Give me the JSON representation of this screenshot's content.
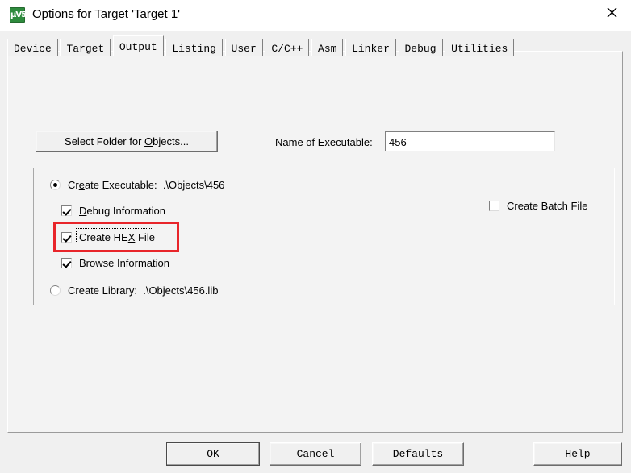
{
  "window": {
    "title": "Options for Target 'Target 1'",
    "icon": "keil-uvision-icon",
    "icon_glyph": "μV5",
    "close_label": "✕"
  },
  "tabs": [
    {
      "label": "Device",
      "selected": false
    },
    {
      "label": "Target",
      "selected": false
    },
    {
      "label": "Output",
      "selected": true
    },
    {
      "label": "Listing",
      "selected": false
    },
    {
      "label": "User",
      "selected": false
    },
    {
      "label": "C/C++",
      "selected": false
    },
    {
      "label": "Asm",
      "selected": false
    },
    {
      "label": "Linker",
      "selected": false
    },
    {
      "label": "Debug",
      "selected": false
    },
    {
      "label": "Utilities",
      "selected": false
    }
  ],
  "output_tab": {
    "select_folder_button": {
      "pre": "Select Folder for ",
      "accel": "O",
      "post": "bjects..."
    },
    "executable_name": {
      "accel": "N",
      "label_rest": "ame of Executable:",
      "value": "456",
      "placeholder": ""
    },
    "group": {
      "create_executable": {
        "pre": "Cr",
        "accel": "e",
        "post": "ate Executable:",
        "path": ".\\Objects\\456",
        "checked": true
      },
      "debug_information": {
        "accel": "D",
        "label_rest": "ebug Information",
        "checked": true
      },
      "create_hex_file": {
        "pre": "Create HE",
        "accel": "X",
        "post": " File",
        "checked": true,
        "focused": true,
        "highlighted": true,
        "highlight_color": "#e8252a"
      },
      "browse_information": {
        "pre": "Bro",
        "accel": "w",
        "post": "se Information",
        "checked": true
      },
      "create_library": {
        "label": "Create Library:",
        "path": ".\\Objects\\456.lib",
        "checked": false
      },
      "create_batch_file": {
        "label": "Create Batch File",
        "checked": false
      }
    }
  },
  "footer": {
    "ok": "OK",
    "cancel": "Cancel",
    "defaults": "Defaults",
    "help": "Help"
  }
}
